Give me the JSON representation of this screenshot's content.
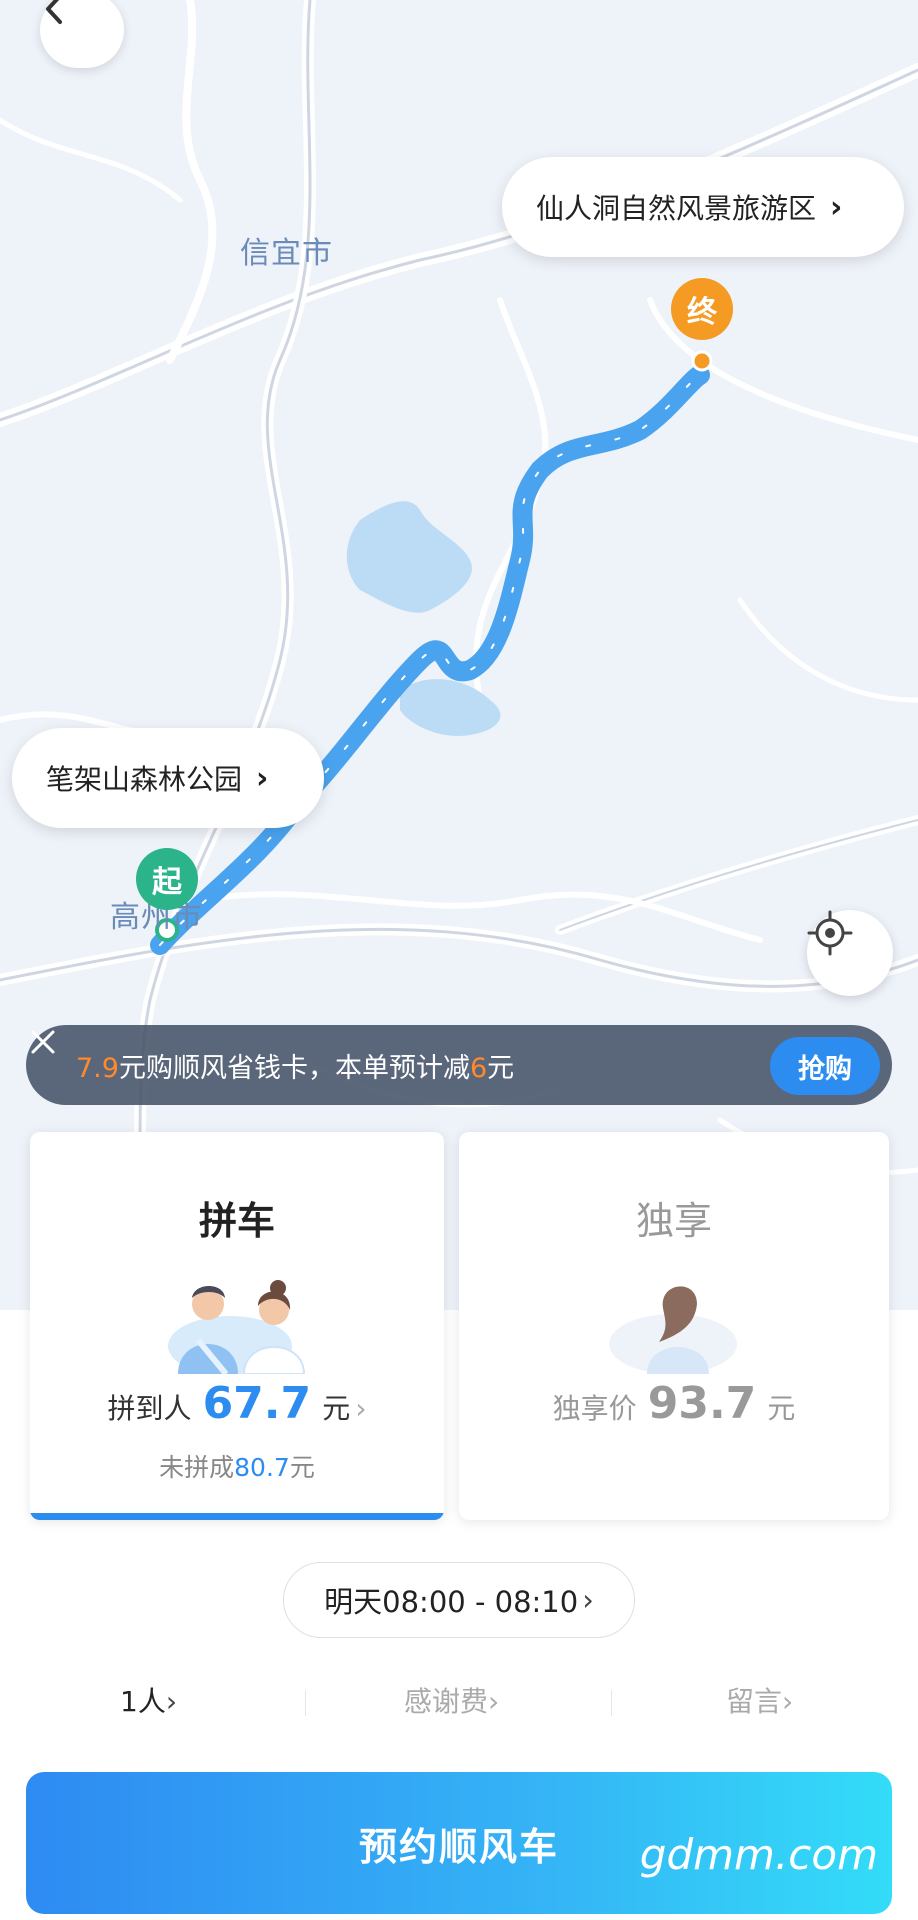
{
  "map": {
    "labels": {
      "city_top": "信宜市",
      "city_start": "高州市"
    },
    "start_pin": "起",
    "end_pin": "终",
    "start_bubble": "笔架山森林公园",
    "end_bubble": "仙人洞自然风景旅游区",
    "chevron": "›"
  },
  "promo": {
    "price_highlight": "7.9",
    "text_middle": "元购顺风省钱卡，本单预计减",
    "discount_highlight": "6",
    "text_end": "元",
    "button": "抢购"
  },
  "cards": {
    "carpool": {
      "title": "拼车",
      "price_prefix": "拼到人",
      "price": "67.7",
      "unit": "元",
      "sub_prefix": "未拼成",
      "sub_price": "80.7",
      "sub_unit": "元",
      "selected": true
    },
    "exclusive": {
      "title": "独享",
      "price_prefix": "独享价",
      "price": "93.7",
      "unit": "元"
    }
  },
  "time": {
    "label": "明天08:00 - 08:10"
  },
  "options": {
    "passengers": "1人",
    "thanks_fee": "感谢费",
    "message": "留言"
  },
  "main_button": "预约顺风车",
  "watermark": "gdmm.com",
  "colors": {
    "accent": "#2d8cf0",
    "route": "#4aa3ee",
    "start": "#2bb38a",
    "end": "#f59a23",
    "highlight": "#ff8a2b"
  },
  "icons": {
    "back": "chevron-left-icon",
    "locate": "crosshair-icon",
    "close": "close-icon"
  }
}
